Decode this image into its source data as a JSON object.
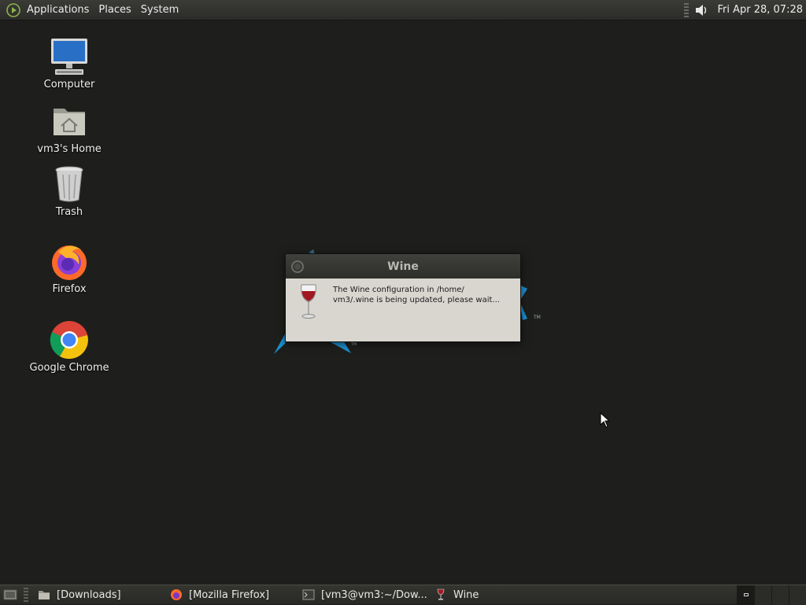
{
  "top_panel": {
    "menus": [
      "Applications",
      "Places",
      "System"
    ],
    "clock": "Fri Apr 28, 07:28",
    "icons": {
      "menu": "gnome-foot-icon",
      "volume": "speaker-icon"
    }
  },
  "desktop_icons": [
    {
      "label": "Computer",
      "icon": "computer-icon"
    },
    {
      "label": "vm3's Home",
      "icon": "home-folder-icon"
    },
    {
      "label": "Trash",
      "icon": "trash-icon"
    },
    {
      "label": "Firefox",
      "icon": "firefox-icon"
    },
    {
      "label": "Google Chrome",
      "icon": "chrome-icon"
    }
  ],
  "dialog": {
    "title": "Wine",
    "message_line1": "The Wine configuration in /home/",
    "message_line2": "vm3/.wine is being updated, please wait...",
    "icon": "wine-glass-icon"
  },
  "taskbar": {
    "tasks": [
      {
        "label": "[Downloads]",
        "icon": "folder-icon"
      },
      {
        "label": "[Mozilla Firefox]",
        "icon": "firefox-icon"
      },
      {
        "label": "[vm3@vm3:~/Dow...",
        "icon": "terminal-icon"
      },
      {
        "label": "Wine",
        "icon": "wine-glass-icon"
      }
    ],
    "workspaces": 4
  },
  "colors": {
    "desktop_bg": "#1e1f1c",
    "panel_bg": "#2e2f2b",
    "dialog_body": "#d9d6d0",
    "logo_blue": "#1d8fd0"
  }
}
